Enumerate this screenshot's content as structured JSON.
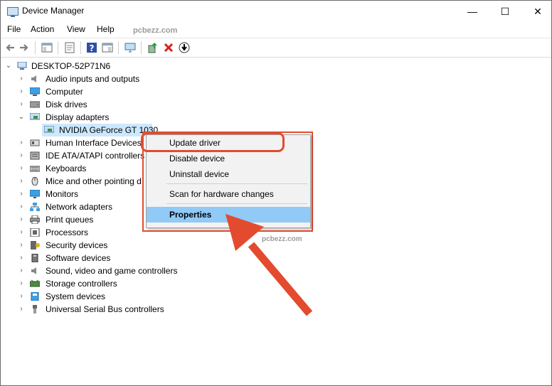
{
  "window": {
    "title": "Device Manager",
    "controls": {
      "minimize": "—",
      "maximize": "☐",
      "close": "✕"
    }
  },
  "menu": {
    "items": [
      "File",
      "Action",
      "View",
      "Help"
    ]
  },
  "watermarks": [
    "pcbezz.com",
    "pcbezz.com"
  ],
  "toolbar": {
    "buttons": [
      "back-icon",
      "forward-icon",
      "console-tree-icon",
      "properties-icon",
      "help-icon",
      "action-pane-icon",
      "monitor-scan-icon",
      "update-driver-icon",
      "uninstall-icon",
      "install-icon"
    ]
  },
  "tree": {
    "root": "DESKTOP-52P71N6",
    "categories": [
      {
        "label": "Audio inputs and outputs",
        "icon": "speaker-icon"
      },
      {
        "label": "Computer",
        "icon": "computer-icon"
      },
      {
        "label": "Disk drives",
        "icon": "disk-icon"
      },
      {
        "label": "Display adapters",
        "icon": "display-adapter-icon",
        "expanded": true
      },
      {
        "label": "NVIDIA GeForce GT 1030",
        "icon": "gpu-icon",
        "child": true,
        "selected": true
      },
      {
        "label": "Human Interface Devices",
        "icon": "hid-icon"
      },
      {
        "label": "IDE ATA/ATAPI controllers",
        "icon": "ide-icon"
      },
      {
        "label": "Keyboards",
        "icon": "keyboard-icon"
      },
      {
        "label": "Mice and other pointing d",
        "icon": "mouse-icon"
      },
      {
        "label": "Monitors",
        "icon": "monitor-icon"
      },
      {
        "label": "Network adapters",
        "icon": "network-icon"
      },
      {
        "label": "Print queues",
        "icon": "printer-icon"
      },
      {
        "label": "Processors",
        "icon": "processor-icon"
      },
      {
        "label": "Security devices",
        "icon": "security-icon"
      },
      {
        "label": "Software devices",
        "icon": "software-icon"
      },
      {
        "label": "Sound, video and game controllers",
        "icon": "sound-icon"
      },
      {
        "label": "Storage controllers",
        "icon": "storage-icon"
      },
      {
        "label": "System devices",
        "icon": "system-icon"
      },
      {
        "label": "Universal Serial Bus controllers",
        "icon": "usb-icon"
      }
    ]
  },
  "context_menu": {
    "items": [
      "Update driver",
      "Disable device",
      "Uninstall device",
      "Scan for hardware changes",
      "Properties"
    ],
    "highlighted": "Properties",
    "callout_color": "#e34b2f",
    "highlight_color": "#91c9f7"
  },
  "colors": {
    "selection": "#cce8ff",
    "annotation_red": "#e34b2f"
  }
}
